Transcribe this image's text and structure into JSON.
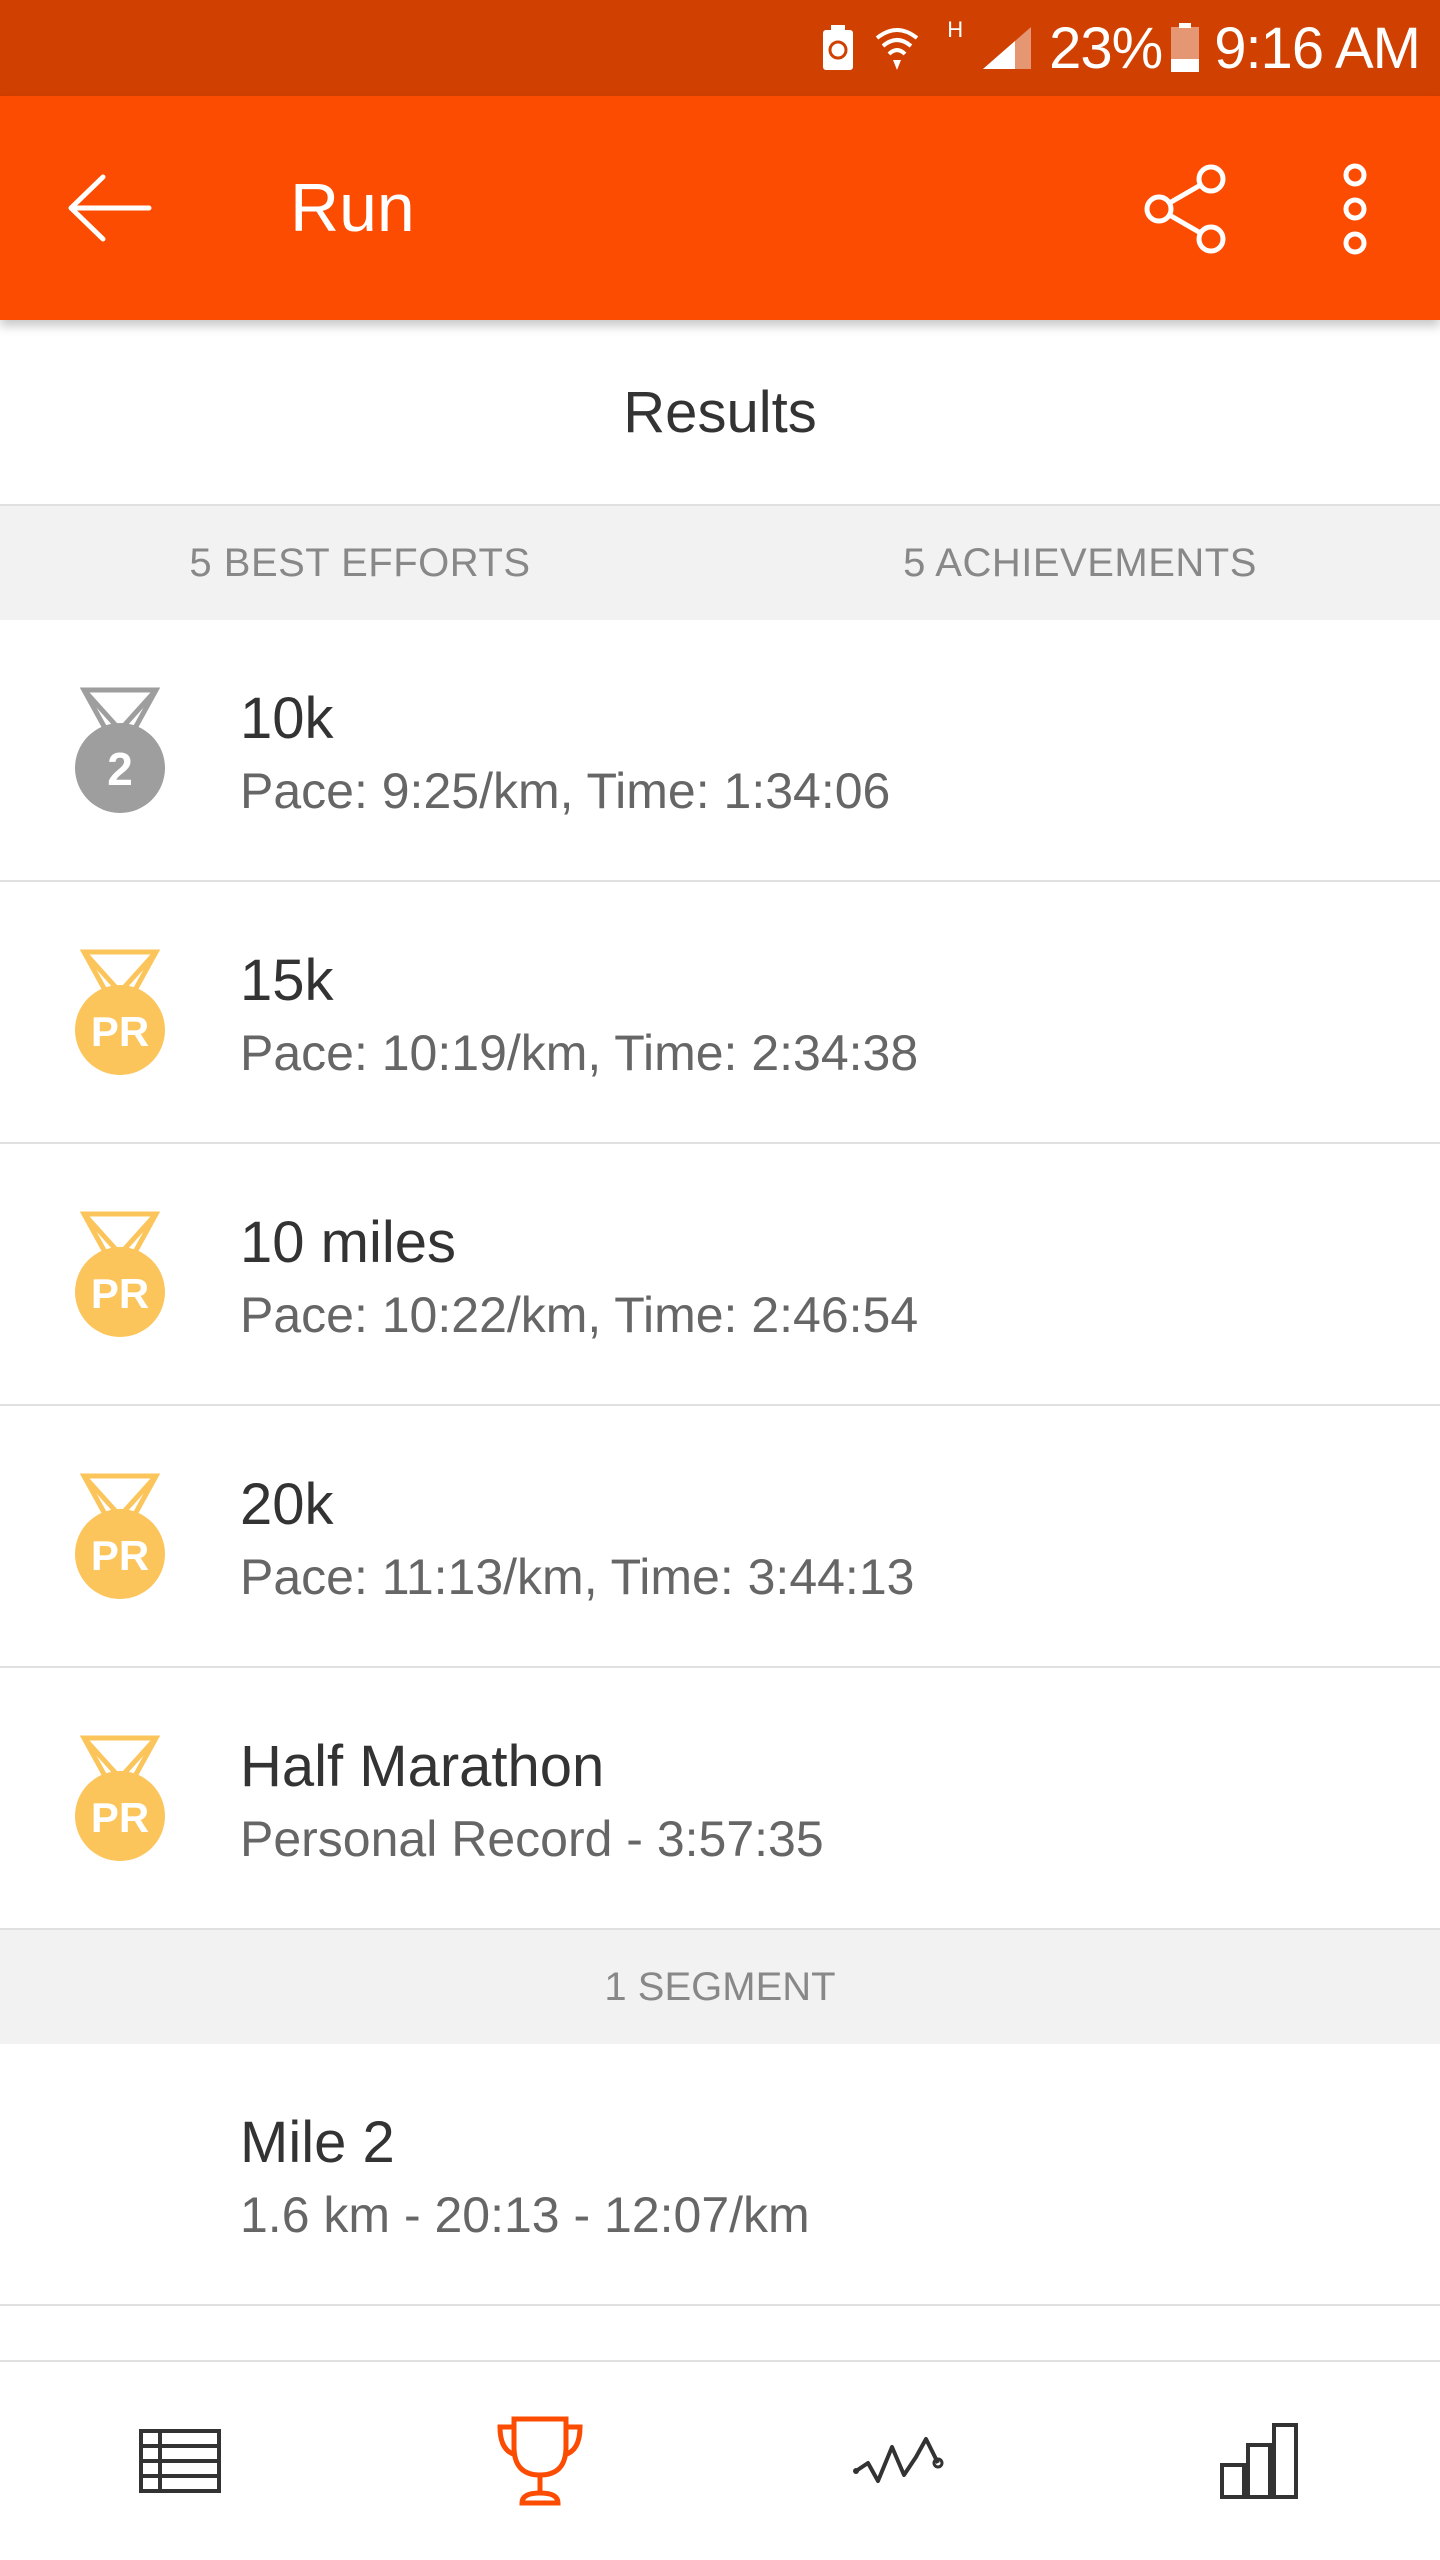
{
  "status_bar": {
    "network_type": "H",
    "battery_percent": "23%",
    "time": "9:16 AM",
    "icons": [
      "battery-saver-icon",
      "wifi-icon",
      "signal-icon",
      "battery-icon"
    ]
  },
  "app_bar": {
    "title": "Run",
    "icons": [
      "back-arrow-icon",
      "share-icon",
      "more-vert-icon"
    ],
    "color": "#fc4c02"
  },
  "results": {
    "header": "Results",
    "tabs": [
      {
        "label": "5 BEST EFFORTS"
      },
      {
        "label": "5 ACHIEVEMENTS"
      }
    ],
    "efforts": [
      {
        "badge": "2",
        "badge_type": "silver",
        "title": "10k",
        "detail": "Pace: 9:25/km, Time: 1:34:06"
      },
      {
        "badge": "PR",
        "badge_type": "gold",
        "title": "15k",
        "detail": "Pace: 10:19/km, Time: 2:34:38"
      },
      {
        "badge": "PR",
        "badge_type": "gold",
        "title": "10 miles",
        "detail": "Pace: 10:22/km, Time: 2:46:54"
      },
      {
        "badge": "PR",
        "badge_type": "gold",
        "title": "20k",
        "detail": "Pace: 11:13/km, Time: 3:44:13"
      },
      {
        "badge": "PR",
        "badge_type": "gold",
        "title": "Half Marathon",
        "detail": "Personal Record - 3:57:35"
      }
    ],
    "segment_header": "1 SEGMENT",
    "segments": [
      {
        "title": "Mile 2",
        "detail": "1.6 km - 20:13 - 12:07/km"
      }
    ]
  },
  "bottom_nav": {
    "items": [
      {
        "icon": "table-icon",
        "active": false
      },
      {
        "icon": "trophy-icon",
        "active": true
      },
      {
        "icon": "activity-graph-icon",
        "active": false
      },
      {
        "icon": "bar-chart-icon",
        "active": false
      }
    ],
    "active_color": "#fc4c02"
  },
  "colors": {
    "gold_medal": "#fcc55c",
    "silver_medal": "#9e9e9e"
  }
}
